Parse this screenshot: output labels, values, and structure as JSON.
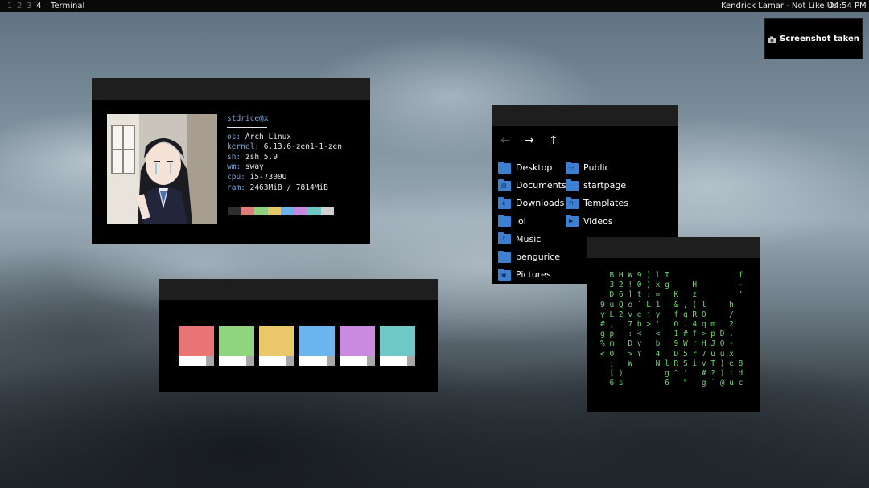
{
  "topbar": {
    "workspaces": [
      "1",
      "2",
      "3",
      "4"
    ],
    "active_workspace": "4",
    "window_title": "Terminal",
    "now_playing": "Kendrick Lamar - Not Like Us",
    "clock": "04:54 PM"
  },
  "notification": {
    "icon": "camera-icon",
    "text": "Screenshot taken"
  },
  "fetch": {
    "user": "stdrice@x",
    "rows": [
      {
        "key": "os:",
        "value": " Arch Linux"
      },
      {
        "key": "kernel:",
        "value": " 6.13.6-zen1-1-zen"
      },
      {
        "key": "sh:",
        "value": " zsh 5.9"
      },
      {
        "key": "wm:",
        "value": " sway"
      },
      {
        "key": "cpu:",
        "value": " i5-7300U"
      },
      {
        "key": "ram:",
        "value": " 2463MiB / 7814MiB"
      }
    ],
    "color_bar": [
      "#2e2e2e",
      "#e47b7b",
      "#8fd17f",
      "#e6c76a",
      "#6bb1ea",
      "#c888e0",
      "#6ec7c4",
      "#cfcfcf"
    ]
  },
  "palette": {
    "colors": [
      "#e87575",
      "#90d47f",
      "#e8c86a",
      "#6cb4ee",
      "#c98ae0",
      "#6ec9c6"
    ]
  },
  "file_manager": {
    "nav": {
      "back": "←",
      "forward": "→",
      "up": "↑"
    },
    "left_items": [
      {
        "label": "Desktop",
        "icon": "folder-icon"
      },
      {
        "label": "Documents",
        "icon": "documents-folder-icon"
      },
      {
        "label": "Downloads",
        "icon": "downloads-folder-icon"
      },
      {
        "label": "lol",
        "icon": "folder-icon"
      },
      {
        "label": "Music",
        "icon": "music-folder-icon"
      },
      {
        "label": "pengurice",
        "icon": "folder-icon"
      },
      {
        "label": "Pictures",
        "icon": "pictures-folder-icon"
      }
    ],
    "right_items": [
      {
        "label": "Public",
        "icon": "public-folder-icon"
      },
      {
        "label": "startpage",
        "icon": "folder-icon"
      },
      {
        "label": "Templates",
        "icon": "templates-folder-icon"
      },
      {
        "label": "Videos",
        "icon": "videos-folder-icon"
      }
    ]
  },
  "matrix": {
    "lines": [
      "  B H W 9 ] l T               f",
      "  3 2 ! 0 ) x g     H         -",
      "  D 6 ] t : =   K   z         '",
      "9 u Q o ` L 1   & , ( l     h",
      "y L 2 v e j y   f g R 0     /",
      "# ,   7 b > '   O . 4 q m   2",
      "g p   : <   <   1 # f > p D .",
      "% m   D v   b   9 W r H J O -",
      "< 0   > Y   4   D 5 r 7 u u x",
      "  ;   W     N l R S i v T ) e 8",
      "  [ )         g ^ '   # ? ) t d",
      "  6 s         6   \"   g ` @ u c"
    ]
  }
}
